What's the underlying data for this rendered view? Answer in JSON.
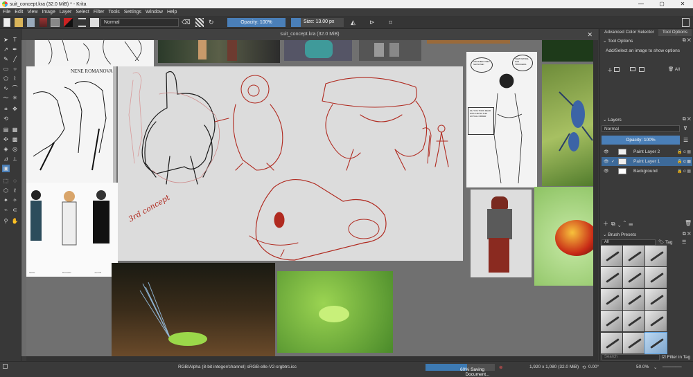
{
  "window": {
    "title": "suit_concept.kra (32.0 MiB) * - Krita",
    "min": "—",
    "max": "▢",
    "close": "✕"
  },
  "menu": [
    "File",
    "Edit",
    "View",
    "Image",
    "Layer",
    "Select",
    "Filter",
    "Tools",
    "Settings",
    "Window",
    "Help"
  ],
  "toolbar": {
    "blend_mode": "Normal",
    "opacity": "Opacity: 100%",
    "size": "Size: 13.00 px"
  },
  "document": {
    "tab_title": "suit_concept.kra (32.0 MiB)",
    "close": "✕"
  },
  "refs": {
    "mecha_caption": "NENE ROMANOVA",
    "sketch_note": "3rd concept",
    "speech_1": "ANOTHER ONE? SHOW ME!",
    "speech_2": "THAT PATROL HAS TRACKERS",
    "speech_3": "OH YOU TOOK DEAD WITH HIM IN THE ACTUAL ORDER",
    "bottom_caption_1": "NENE",
    "bottom_caption_2": "BACHER",
    "bottom_caption_3": "JACOB"
  },
  "dock": {
    "tab_1": "Advanced Color Selector",
    "tab_2": "Tool Options",
    "tool_options_header": "Tool Options",
    "tool_options_hint": "Add/Select an image to show options",
    "all_btn": "All",
    "layers_header": "Layers",
    "layers_blend": "Normal",
    "layers_opacity": "Opacity:  100%",
    "layers": [
      {
        "name": "Paint Layer 2"
      },
      {
        "name": "Paint Layer 1"
      },
      {
        "name": "Background"
      }
    ],
    "brush_header": "Brush Presets",
    "brush_filter": "All",
    "tag_label": "Tag",
    "search_placeholder": "Search",
    "filter_in_tag": "Filter in Tag"
  },
  "status": {
    "color_space": "RGB/Alpha (8-bit integer/channel)  sRGB-elle-V2-srgbtrc.icc",
    "saving_label": "Saving Document...",
    "saving_value": "60%",
    "saving_progress": 0.6,
    "dimensions": "1,920 x 1,080 (32.0 MiB)",
    "rotation": "0.00°",
    "zoom": "50.0%"
  },
  "colors": {
    "accent": "#3d7ab3",
    "sketch_red": "#b02a20",
    "sketch_black": "#1a1a1a",
    "canvas_bg": "#dcdcdc"
  }
}
